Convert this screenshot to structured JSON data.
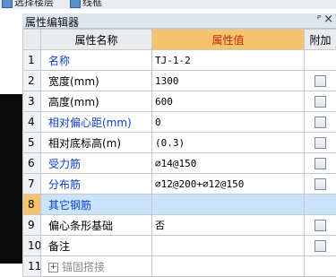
{
  "toolbar": {
    "item1_label": "选择楼层",
    "item2_label": "线框"
  },
  "panel": {
    "title": "属性编辑器",
    "pin_glyph": "ᴾ",
    "close_glyph": "×"
  },
  "table": {
    "headers": {
      "name": "属性名称",
      "value": "属性值",
      "attach": "附加"
    },
    "rows": [
      {
        "idx": "1",
        "name": "名称",
        "value": "TJ-1-2",
        "name_color": "blue",
        "checkbox": false
      },
      {
        "idx": "2",
        "name": "宽度(mm)",
        "value": "1300",
        "name_color": "black",
        "checkbox": true
      },
      {
        "idx": "3",
        "name": "高度(mm)",
        "value": "600",
        "name_color": "black",
        "checkbox": true
      },
      {
        "idx": "4",
        "name": "相对偏心距(mm)",
        "value": "0",
        "name_color": "blue",
        "checkbox": true
      },
      {
        "idx": "5",
        "name": "相对底标高(m)",
        "value": "(0.3)",
        "name_color": "black",
        "checkbox": true
      },
      {
        "idx": "6",
        "name": "受力筋",
        "value": "⌀14@150",
        "name_color": "blue",
        "checkbox": true
      },
      {
        "idx": "7",
        "name": "分布筋",
        "value": "⌀12@200+⌀12@150",
        "name_color": "blue",
        "checkbox": true
      },
      {
        "idx": "8",
        "name": "其它钢筋",
        "value": "",
        "name_color": "blue",
        "checkbox": false,
        "selected": true
      },
      {
        "idx": "9",
        "name": "偏心条形基础",
        "value": "否",
        "name_color": "black",
        "checkbox": true
      },
      {
        "idx": "10",
        "name": "备注",
        "value": "",
        "name_color": "black",
        "checkbox": true
      },
      {
        "idx": "11",
        "name": "锚固搭接",
        "value": "",
        "name_color": "grey",
        "checkbox": false,
        "expander": "+"
      }
    ]
  }
}
